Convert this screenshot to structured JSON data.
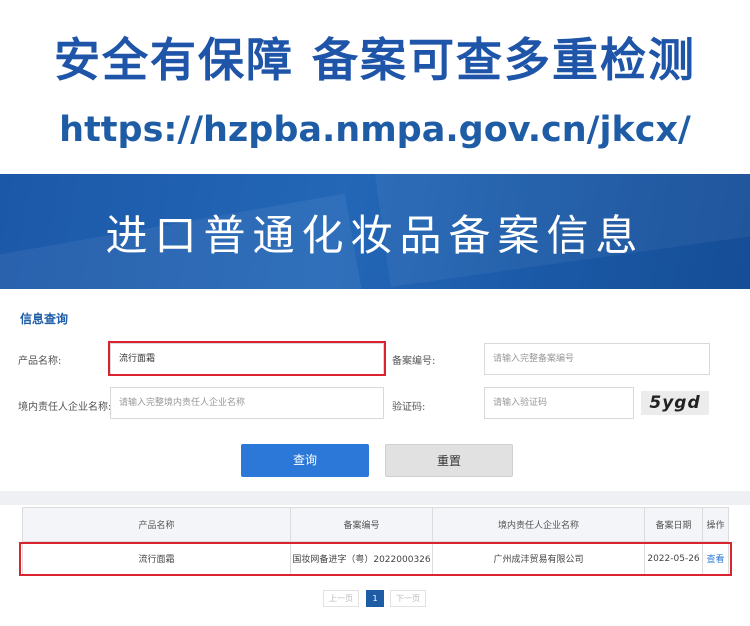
{
  "header": {
    "headline": "安全有保障 备案可查多重检测",
    "url": "https://hzpba.nmpa.gov.cn/jkcx/"
  },
  "banner": {
    "title": "进口普通化妆品备案信息"
  },
  "search_form": {
    "section_title": "信息查询",
    "product_name_label": "产品名称:",
    "product_name_value": "流行面霜",
    "record_no_label": "备案编号:",
    "record_no_placeholder": "请输入完整备案编号",
    "company_label": "境内责任人企业名称:",
    "company_placeholder": "请输入完整境内责任人企业名称",
    "captcha_label": "验证码:",
    "captcha_placeholder": "请输入验证码",
    "captcha_image_text": "5ygd",
    "query_button": "查询",
    "reset_button": "重置"
  },
  "results_table": {
    "columns": [
      "产品名称",
      "备案编号",
      "境内责任人企业名称",
      "备案日期",
      "操作"
    ],
    "rows": [
      {
        "product_name": "流行面霜",
        "record_no": "国妆网备进字（粤）2022000326",
        "company": "广州成沣贸易有限公司",
        "date": "2022-05-26",
        "action": "查看"
      }
    ]
  },
  "pagination": {
    "prev": "上一页",
    "current": "1",
    "next": "下一页"
  },
  "colors": {
    "brand_blue": "#1f55a8",
    "highlight_red": "#d9232e",
    "button_blue": "#2b78d8"
  }
}
